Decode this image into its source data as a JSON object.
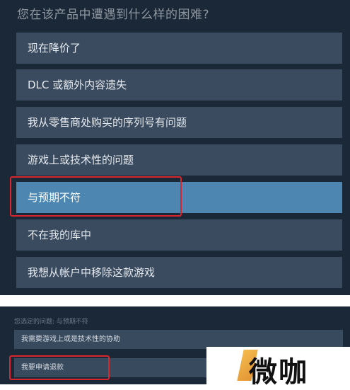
{
  "top_panel": {
    "question": "您在该产品中遭遇到什么样的困难?",
    "options": [
      {
        "label": "现在降价了",
        "selected": false
      },
      {
        "label": "DLC 或额外内容遗失",
        "selected": false
      },
      {
        "label": "我从零售商处购买的序列号有问题",
        "selected": false
      },
      {
        "label": "游戏上或技术性的问题",
        "selected": false
      },
      {
        "label": "与预期不符",
        "selected": true
      },
      {
        "label": "不在我的库中",
        "selected": false
      },
      {
        "label": "我想从帐户中移除这款游戏",
        "selected": false
      }
    ]
  },
  "bottom_panel": {
    "selected_issue": "您选定的问题: 与预期不符",
    "options": [
      {
        "label": "我需要游戏上或是技术性的协助"
      },
      {
        "label": "我要申请退款"
      }
    ]
  },
  "watermark": {
    "text": "微咖"
  },
  "colors": {
    "panel_bg": "#1b2838",
    "option_bg": "#3a4b5f",
    "selected_bg": "#4d87b1",
    "highlight_border": "#d9262c"
  }
}
